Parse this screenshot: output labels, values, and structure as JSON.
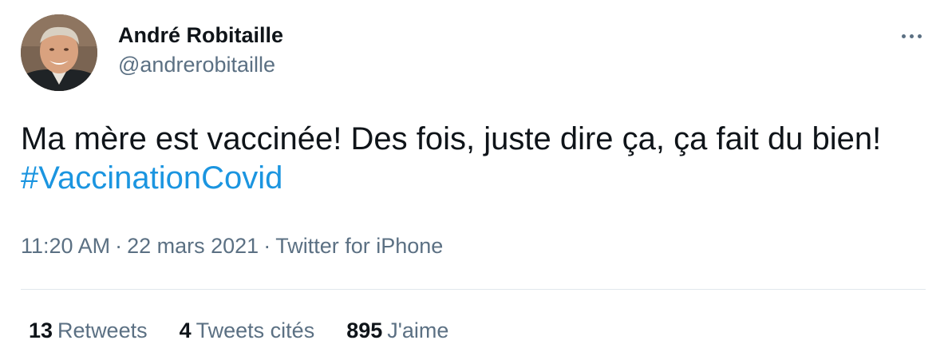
{
  "author": {
    "display_name": "André Robitaille",
    "handle": "@andrerobitaille",
    "avatar_icon": "user-avatar-photo"
  },
  "more_icon": "more-dots-icon",
  "tweet": {
    "text": "Ma mère est vaccinée! Des fois, juste dire ça, ça fait du bien! ",
    "hashtag": "#VaccinationCovid",
    "time": "11:20 AM",
    "separator": "·",
    "date": "22 mars 2021",
    "source": "Twitter for iPhone"
  },
  "stats": {
    "retweets": {
      "count": "13",
      "label": "Retweets"
    },
    "quotes": {
      "count": "4",
      "label": "Tweets cités"
    },
    "likes": {
      "count": "895",
      "label": "J'aime"
    }
  },
  "colors": {
    "text": "#0f1419",
    "secondary": "#5b7083",
    "link": "#1b95e0",
    "divider": "#e1e8ed"
  }
}
